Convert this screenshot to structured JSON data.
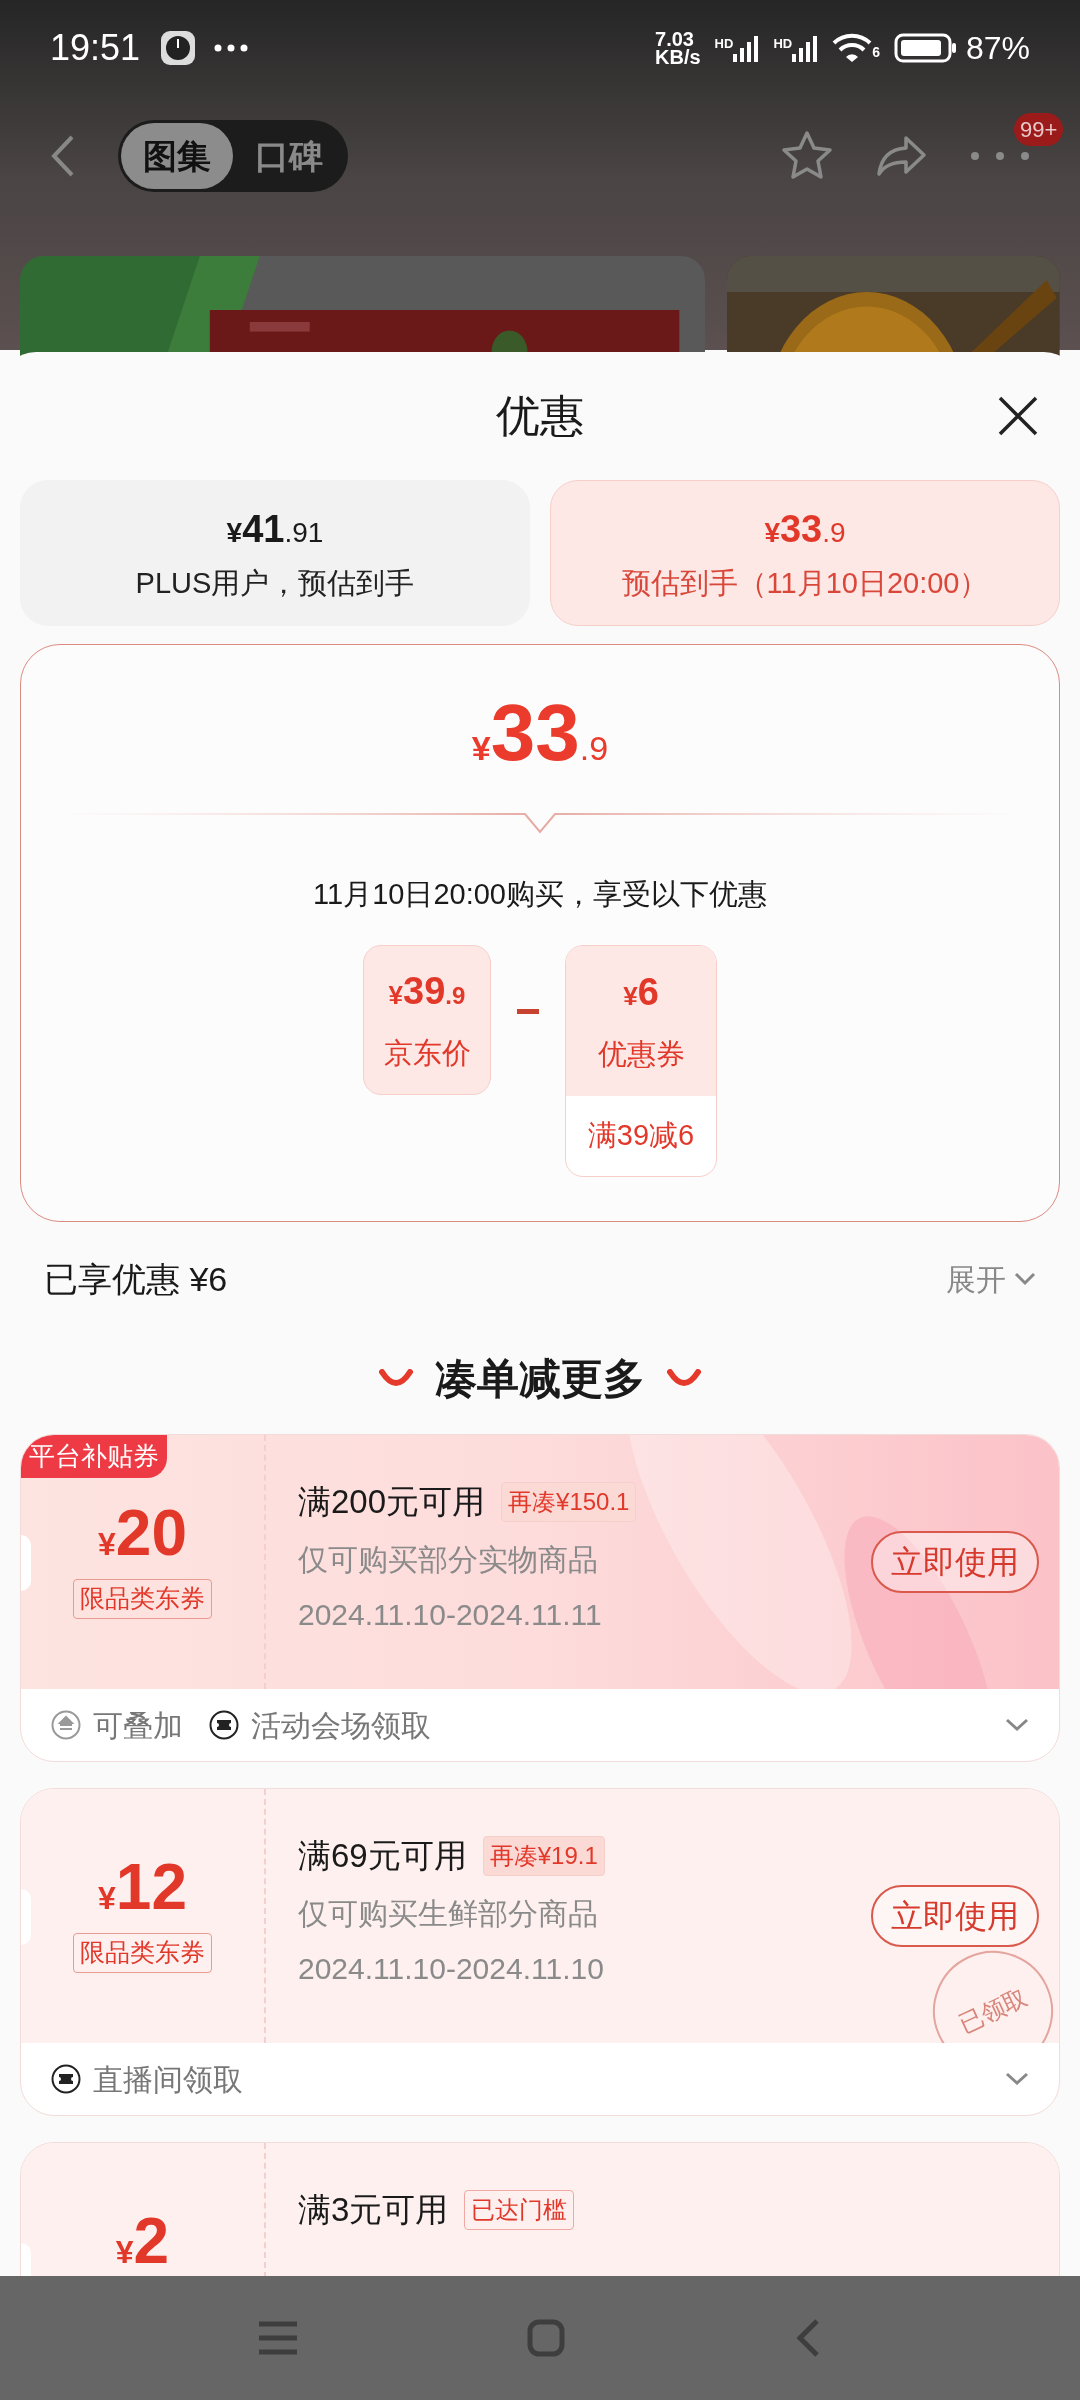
{
  "status_bar": {
    "time": "19:51",
    "net_speed": "7.03",
    "net_unit": "KB/s",
    "signals": [
      "HD",
      "HD"
    ],
    "wifi_label": "6",
    "battery": "87%"
  },
  "header": {
    "tabs": [
      {
        "label": "图集",
        "selected": true
      },
      {
        "label": "口碑",
        "selected": false
      }
    ],
    "badge": "99+"
  },
  "sheet": {
    "title": "优惠",
    "options": [
      {
        "price": "¥41.91",
        "label": "PLUS用户，预估到手",
        "selected": false
      },
      {
        "price": "¥33.9",
        "label": "预估到手（11月10日20:00）",
        "selected": true
      }
    ],
    "detail": {
      "price": "¥33.9",
      "note": "11月10日20:00购买，享受以下优惠",
      "terms": [
        {
          "kind": "price",
          "amount": "¥39.9",
          "label": "京东价"
        },
        {
          "kind": "minus"
        },
        {
          "kind": "coupon",
          "amount": "¥6",
          "label": "优惠券",
          "rule": "满39减6"
        }
      ]
    },
    "enjoyed": "已享优惠 ¥6",
    "expand": "展开",
    "more_title": "凑单减更多",
    "coupons": [
      {
        "kind": "featured",
        "tag": "平台补贴券",
        "amount": "¥20",
        "scope": "限品类东券",
        "condition": "满200元可用",
        "hint": {
          "kind": "shortfall",
          "text": "再凑¥150.1"
        },
        "desc": "仅可购买部分实物商品",
        "dates": "2024.11.10-2024.11.11",
        "action": "立即使用",
        "footer": [
          {
            "kind": "stack",
            "text": "可叠加"
          },
          {
            "kind": "ticket",
            "text": "活动会场领取"
          }
        ]
      },
      {
        "kind": "plain",
        "amount": "¥12",
        "scope": "限品类东券",
        "condition": "满69元可用",
        "hint": {
          "kind": "shortfall",
          "text": "再凑¥19.1"
        },
        "desc": "仅可购买生鲜部分商品",
        "dates": "2024.11.10-2024.11.10",
        "action": "立即使用",
        "stamp": "已领取",
        "footer": [
          {
            "kind": "ticket",
            "text": "直播间领取"
          }
        ]
      },
      {
        "kind": "plain",
        "amount": "¥2",
        "condition": "满3元可用",
        "hint": {
          "kind": "reached",
          "text": "已达门槛"
        }
      }
    ]
  }
}
